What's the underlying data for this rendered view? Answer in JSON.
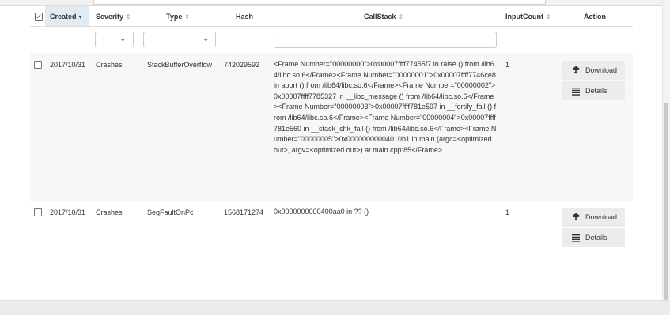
{
  "table": {
    "headers": {
      "created": "Created",
      "severity": "Severity",
      "type": "Type",
      "hash": "Hash",
      "callstack": "CallStack",
      "inputcount": "InputCount",
      "action": "Action"
    },
    "sort_indicators": {
      "active": "▾",
      "inactive": "⇕"
    },
    "filters": {
      "severity_value": "",
      "type_value": "",
      "callstack_value": "",
      "callstack_placeholder": ""
    },
    "rows": [
      {
        "created": "2017/10/31",
        "severity": "Crashes",
        "type": "StackBufferOverflow",
        "hash": "742029592",
        "callstack": "<Frame Number=\"00000000\">0x00007ffff77455f7 in raise () from /lib64/libc.so.6</Frame><Frame Number=\"00000001\">0x00007ffff7746ce8 in abort () from /lib64/libc.so.6</Frame><Frame Number=\"00000002\">0x00007ffff7785327 in __libc_message () from /lib64/libc.so.6</Frame><Frame Number=\"00000003\">0x00007ffff781e597 in __fortify_fail () from /lib64/libc.so.6</Frame><Frame Number=\"00000004\">0x00007ffff781e560 in __stack_chk_fail () from /lib64/libc.so.6</Frame><Frame Number=\"00000005\">0x00000000004010b1 in main (argc=<optimized out>, argv=<optimized out>) at main.cpp:85</Frame>",
        "inputcount": "1",
        "download_label": "Download",
        "details_label": "Details"
      },
      {
        "created": "2017/10/31",
        "severity": "Crashes",
        "type": "SegFaultOnPc",
        "hash": "1568171274",
        "callstack": "0x0000000000400aa0 in ?? ()",
        "inputcount": "1",
        "download_label": "Download",
        "details_label": "Details"
      }
    ]
  },
  "icons": {
    "download": "cloud-download-icon",
    "details": "list-icon"
  }
}
